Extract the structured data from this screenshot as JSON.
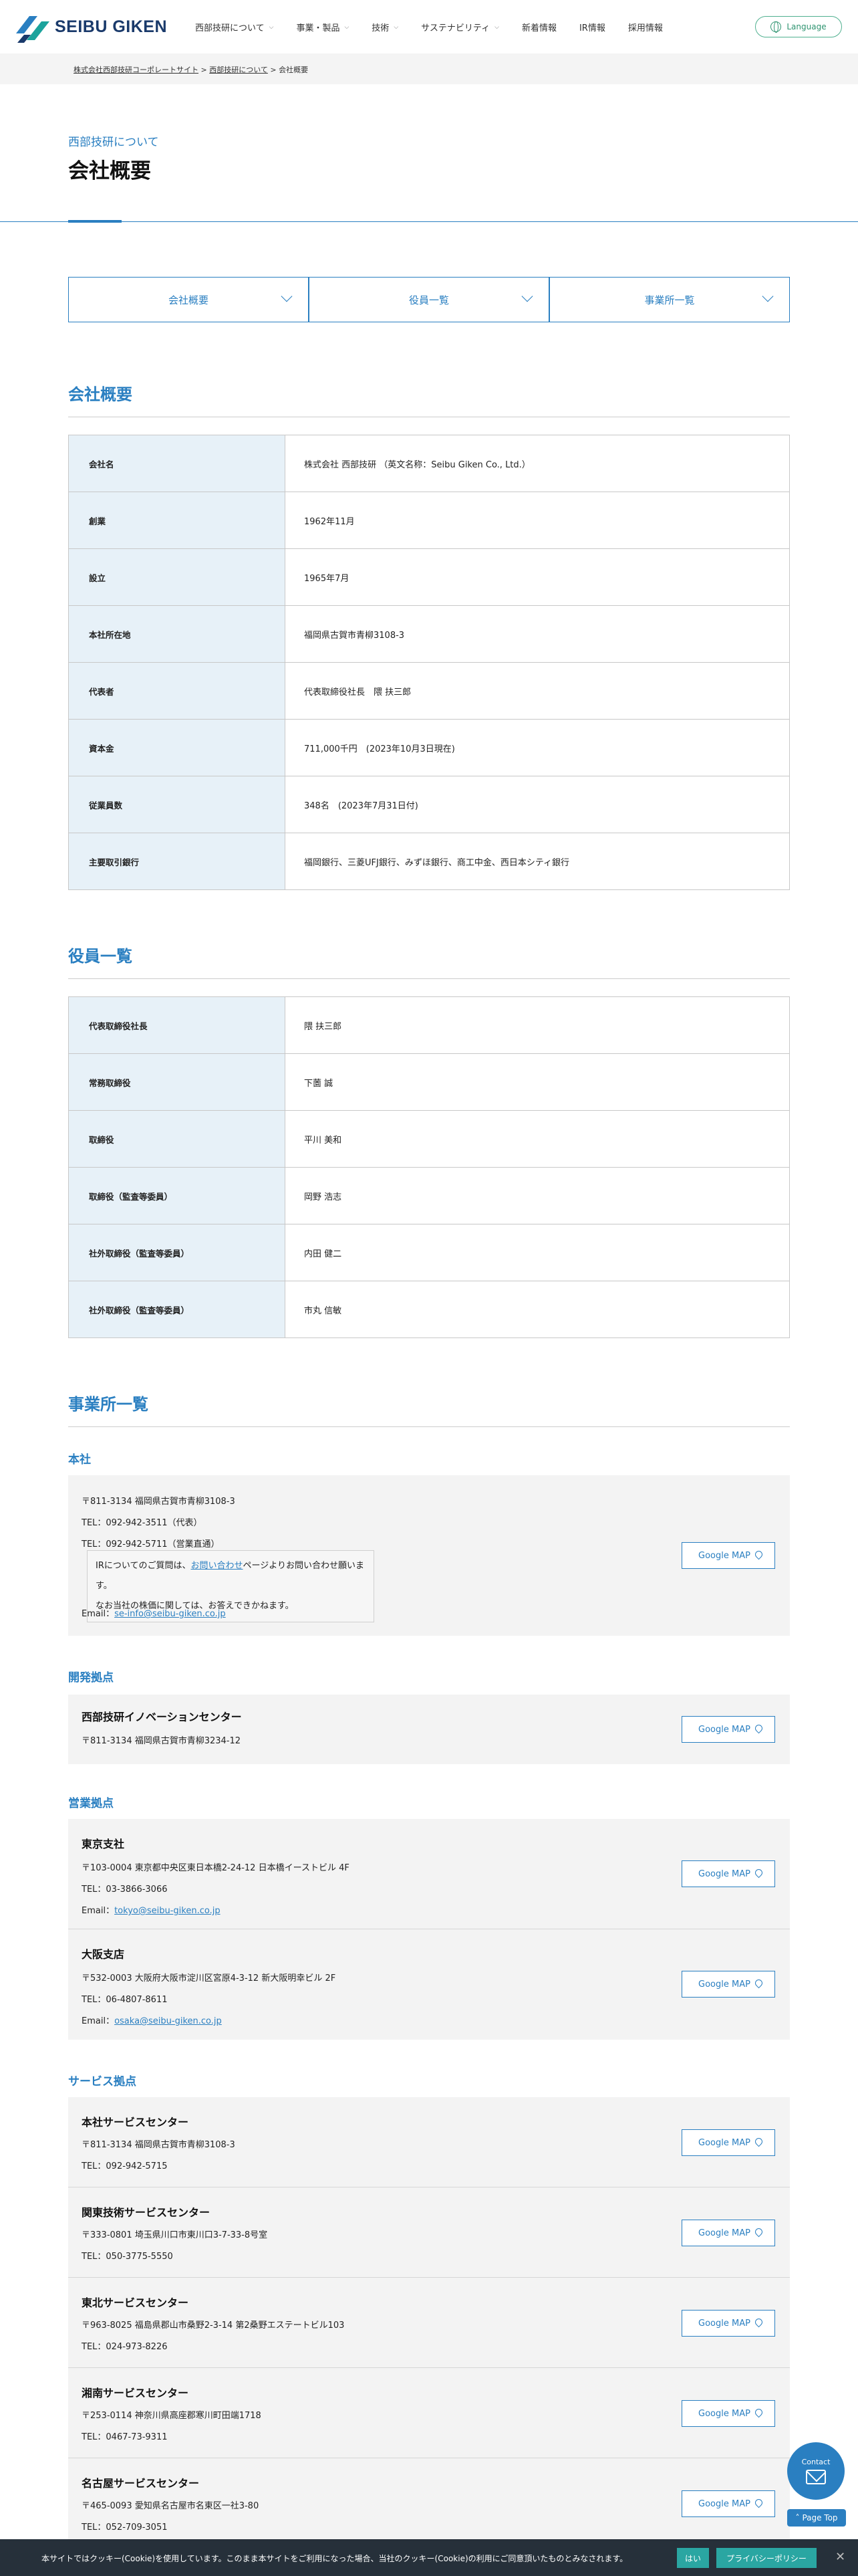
{
  "header": {
    "logo_text": "SEIBU GIKEN",
    "nav": [
      {
        "label": "西部技研について",
        "has_menu": true
      },
      {
        "label": "事業・製品",
        "has_menu": true
      },
      {
        "label": "技術",
        "has_menu": true
      },
      {
        "label": "サステナビリティ",
        "has_menu": true
      },
      {
        "label": "新着情報",
        "has_menu": false
      },
      {
        "label": "IR情報",
        "has_menu": false
      },
      {
        "label": "採用情報",
        "has_menu": false
      }
    ],
    "language": "Language"
  },
  "breadcrumb": {
    "home": "株式会社西部技研コーポレートサイト",
    "parent": "西部技研について",
    "sep": ">",
    "current": "会社概要"
  },
  "page": {
    "subtitle": "西部技研について",
    "title": "会社概要"
  },
  "anchors": [
    "会社概要",
    "役員一覧",
    "事業所一覧"
  ],
  "overview": {
    "heading": "会社概要",
    "rows": [
      {
        "k": "会社名",
        "v": "株式会社 西部技研 （英文名称：Seibu Giken Co., Ltd.）"
      },
      {
        "k": "創業",
        "v": "1962年11月"
      },
      {
        "k": "設立",
        "v": "1965年7月"
      },
      {
        "k": "本社所在地",
        "v": "福岡県古賀市青柳3108-3"
      },
      {
        "k": "代表者",
        "v": "代表取締役社長　隈 扶三郎"
      },
      {
        "k": "資本金",
        "v": "711,000千円　(2023年10月3日現在)"
      },
      {
        "k": "従業員数",
        "v": "348名　(2023年7月31日付)"
      },
      {
        "k": "主要取引銀行",
        "v": "福岡銀行、三菱UFJ銀行、みずほ銀行、商工中金、西日本シティ銀行"
      }
    ]
  },
  "officers": {
    "heading": "役員一覧",
    "rows": [
      {
        "k": "代表取締役社長",
        "v": "隈 扶三郎"
      },
      {
        "k": "常務取締役",
        "v": "下薗 誠"
      },
      {
        "k": "取締役",
        "v": "平川 美和"
      },
      {
        "k": "取締役（監査等委員）",
        "v": "岡野 浩志"
      },
      {
        "k": "社外取締役（監査等委員）",
        "v": "内田 健二"
      },
      {
        "k": "社外取締役（監査等委員）",
        "v": "市丸 信敏"
      }
    ]
  },
  "offices": {
    "heading": "事業所一覧",
    "map_label": "Google MAP",
    "honsha": {
      "heading": "本社",
      "address": "〒811-3134 福岡県古賀市青柳3108-3",
      "tel1": "TEL：092-942-3511（代表）",
      "tel2": "TEL：092-942-5711（営業直通）",
      "note_prefix": "IRについてのご質問は、",
      "note_link": "お問い合わせ",
      "note_suffix": "ページよりお問い合わせ願います。",
      "note2": "なお当社の株価に関しては、お答えできかねます。",
      "email_label": "Email：",
      "email": "se-info@seibu-giken.co.jp"
    },
    "dev": {
      "heading": "開発拠点",
      "items": [
        {
          "name": "西部技研イノベーションセンター",
          "address": "〒811-3134 福岡県古賀市青柳3234-12"
        }
      ]
    },
    "sales": {
      "heading": "営業拠点",
      "items": [
        {
          "name": "東京支社",
          "address": "〒103-0004 東京都中央区東日本橋2-24-12 日本橋イーストビル 4F",
          "tel": "TEL：03-3866-3066",
          "email_label": "Email：",
          "email": "tokyo@seibu-giken.co.jp"
        },
        {
          "name": "大阪支店",
          "address": "〒532-0003 大阪府大阪市淀川区宮原4-3-12 新大阪明幸ビル 2F",
          "tel": "TEL：06-4807-8611",
          "email_label": "Email：",
          "email": "osaka@seibu-giken.co.jp"
        }
      ]
    },
    "service": {
      "heading": "サービス拠点",
      "items": [
        {
          "name": "本社サービスセンター",
          "address": "〒811-3134 福岡県古賀市青柳3108-3",
          "tel": "TEL：092-942-5715"
        },
        {
          "name": "関東技術サービスセンター",
          "address": "〒333-0801 埼玉県川口市東川口3-7-33-8号室",
          "tel": "TEL：050-3775-5550"
        },
        {
          "name": "東北サービスセンター",
          "address": "〒963-8025 福島県郡山市桑野2-3-14 第2桑野エステートビル103",
          "tel": "TEL：024-973-8226"
        },
        {
          "name": "湘南サービスセンター",
          "address": "〒253-0114 神奈川県高座郡寒川町田端1718",
          "tel": "TEL：0467-73-9311"
        },
        {
          "name": "名古屋サービスセンター",
          "address": "〒465-0093 愛知県名古屋市名東区一社3-80",
          "tel": "TEL：052-709-3051"
        }
      ]
    }
  },
  "floating": {
    "contact": "Contact",
    "pagetop": "Page Top"
  },
  "cookie": {
    "message": "本サイトではクッキー(Cookie)を使用しています。このまま本サイトをご利用になった場合、当社のクッキー(Cookie)の利用にご同意頂いたものとみなされます。",
    "yes": "はい",
    "policy": "プライバシーポリシー",
    "close": "✕"
  },
  "colors": {
    "accent": "#2a7fc1",
    "label_bg": "#e7f1f8",
    "green": "#2e9470",
    "cookie_bg": "#26303a",
    "cookie_btn": "#2aa6a2"
  }
}
